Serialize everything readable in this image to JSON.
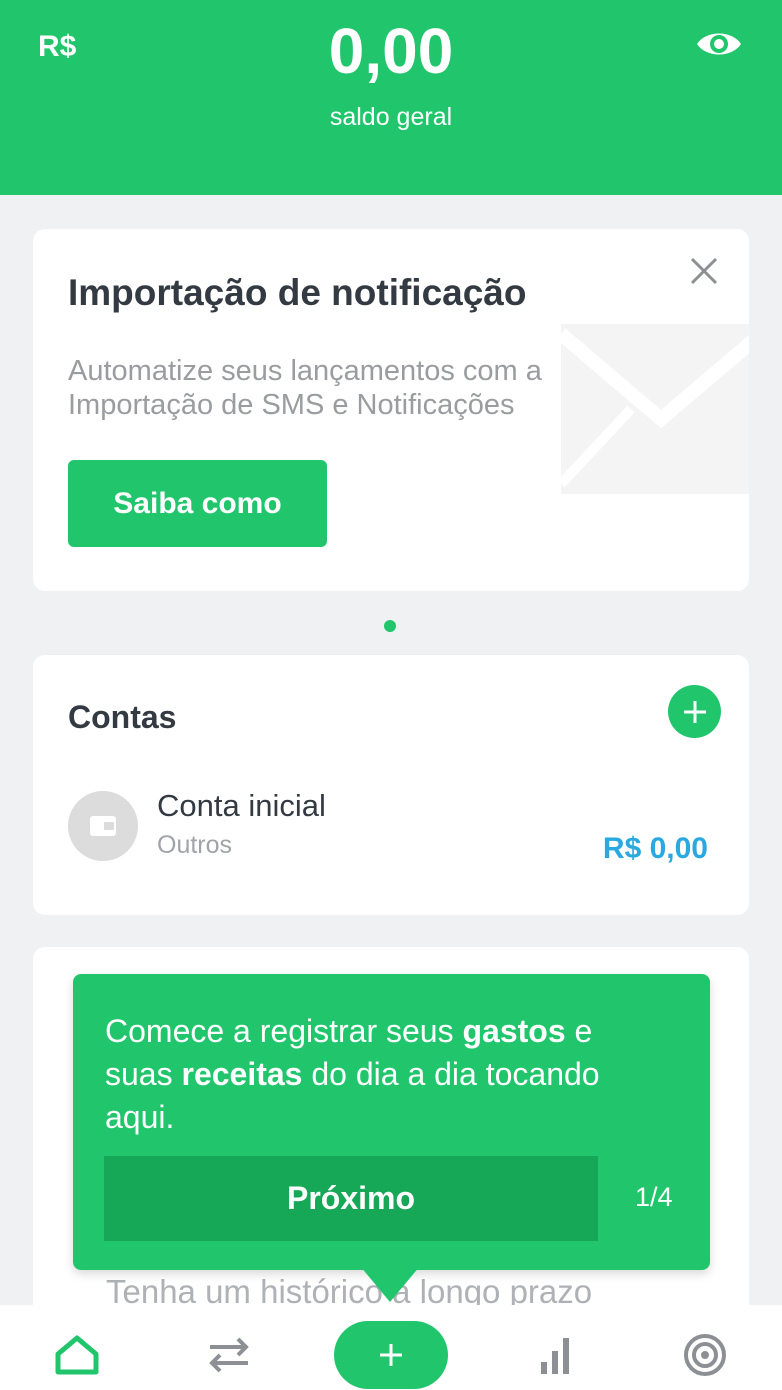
{
  "header": {
    "currency": "R$",
    "balance": "0,00",
    "balance_label": "saldo geral"
  },
  "notification_card": {
    "title": "Importação de notificação",
    "description": "Automatize seus lançamentos com a Importação de SMS e Notificações",
    "button_label": "Saiba como"
  },
  "accounts": {
    "title": "Contas",
    "items": [
      {
        "name": "Conta inicial",
        "type": "Outros",
        "balance": "R$ 0,00"
      }
    ]
  },
  "lower_card": {
    "partial_text": "Tenha um histórico a longo prazo"
  },
  "tooltip": {
    "text_part1": "Comece a registrar seus ",
    "text_bold1": "gastos",
    "text_part2": " e suas ",
    "text_bold2": "receitas",
    "text_part3": " do dia a dia tocando aqui.",
    "next_label": "Próximo",
    "step": "1/4"
  },
  "bottom_nav": {
    "items": [
      "home-icon",
      "transfer-icon",
      "add-icon",
      "chart-icon",
      "target-icon"
    ]
  },
  "colors": {
    "brand": "#21c66c",
    "brand_dark": "#17a857",
    "balance_blue": "#2aa8e0"
  }
}
